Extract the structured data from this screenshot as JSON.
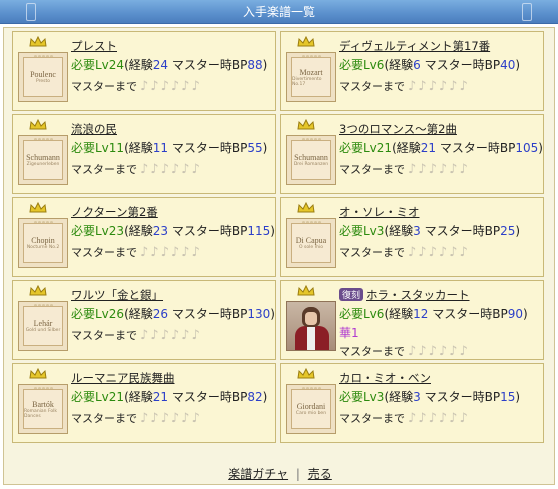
{
  "title": "入手楽譜一覧",
  "cards": [
    {
      "name": "プレスト",
      "composer": "Poulenc",
      "sub": "Presto",
      "lv": "24",
      "exp": "24",
      "bp": "88",
      "icon": "music-sheet-icon"
    },
    {
      "name": "ディヴェルティメント第17番",
      "composer": "Mozart",
      "sub": "Divertimento No.17",
      "lv": "6",
      "exp": "6",
      "bp": "40",
      "icon": "music-sheet-icon"
    },
    {
      "name": "流浪の民",
      "composer": "Schumann",
      "sub": "Zigeunerleben",
      "lv": "11",
      "exp": "11",
      "bp": "55",
      "icon": "music-sheet-icon"
    },
    {
      "name": "3つのロマンス～第2曲",
      "composer": "Schumann",
      "sub": "Drei Romanzen",
      "lv": "21",
      "exp": "21",
      "bp": "105",
      "icon": "music-sheet-icon"
    },
    {
      "name": "ノクターン第2番",
      "composer": "Chopin",
      "sub": "Nocturne No.2",
      "lv": "23",
      "exp": "23",
      "bp": "115",
      "icon": "music-sheet-icon"
    },
    {
      "name": "オ・ソレ・ミオ",
      "composer": "Di Capua",
      "sub": "O sole mio",
      "lv": "3",
      "exp": "3",
      "bp": "25",
      "icon": "music-sheet-icon"
    },
    {
      "name": "ワルツ「金と銀」",
      "composer": "Lehár",
      "sub": "Gold und Silber",
      "lv": "26",
      "exp": "26",
      "bp": "130",
      "icon": "music-sheet-icon"
    },
    {
      "name": "ホラ・スタッカート",
      "badge": "復刻",
      "composer": "Dinicu",
      "sub": "",
      "lv": "6",
      "exp": "12",
      "bp": "90",
      "hana": "華1",
      "portrait": true
    },
    {
      "name": "ルーマニア民族舞曲",
      "composer": "Bartók",
      "sub": "Romanian Folk Dances",
      "lv": "21",
      "exp": "21",
      "bp": "82",
      "icon": "music-sheet-icon"
    },
    {
      "name": "カロ・ミオ・ベン",
      "composer": "Giordani",
      "sub": "Caro mio ben",
      "lv": "3",
      "exp": "3",
      "bp": "15",
      "icon": "music-sheet-icon"
    }
  ],
  "labels": {
    "required": "必要Lv",
    "exp": "(経験",
    "master_bp": " マスター時BP",
    "close": ")",
    "master_until": "マスターまで",
    "notes": "♪♪♪♪♪♪"
  },
  "footer": {
    "gacha": "楽譜ガチャ",
    "separator": "|",
    "sell": "売る"
  },
  "colors": {
    "level": "#2c8a0e",
    "number": "#2c3fc8",
    "hana": "#b03ad0",
    "title_bar": "#5a8fcc"
  }
}
